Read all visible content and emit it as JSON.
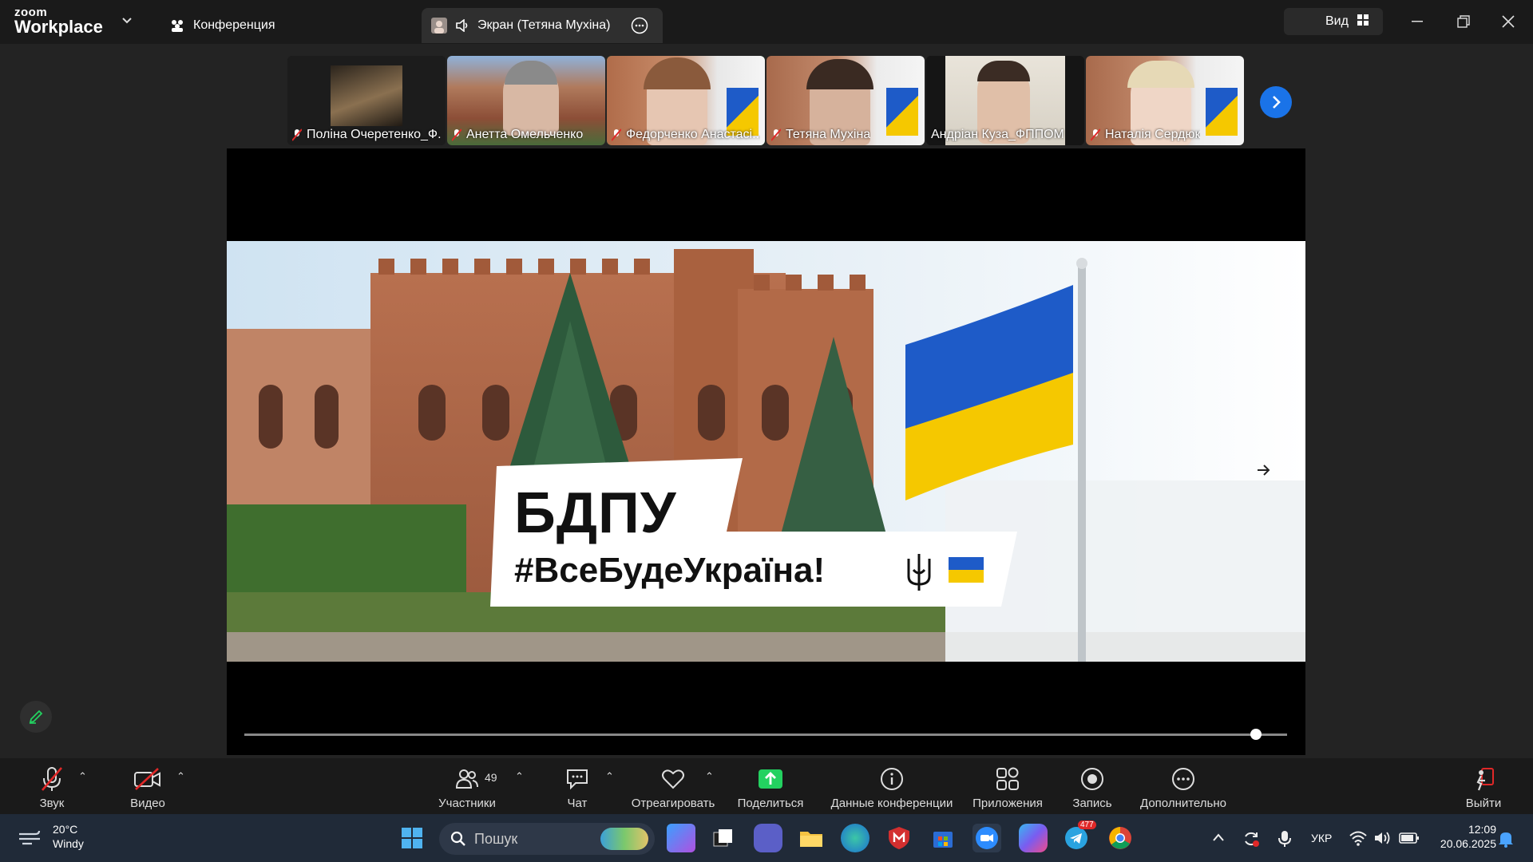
{
  "app": {
    "logo_top": "zoom",
    "logo_bottom": "Workplace"
  },
  "tabs": {
    "conference": "Конференция",
    "screen_share": "Экран (Тетяна Мухіна)"
  },
  "header": {
    "view_label": "Вид"
  },
  "participants": [
    {
      "name": "Поліна Очеретенко_Ф...",
      "muted": true
    },
    {
      "name": "Анетта Омельченко",
      "muted": true
    },
    {
      "name": "Федорченко Анастасі...",
      "muted": true,
      "active_speaker": true
    },
    {
      "name": "Тетяна Мухіна",
      "muted": true
    },
    {
      "name": "Андріан Куза_ФППОМ",
      "muted": false
    },
    {
      "name": "Наталія Сердюк",
      "muted": true
    }
  ],
  "slide": {
    "title": "БДПУ",
    "hashtag": "#ВсеБудеУкраїна!",
    "flag_colors": [
      "#1e5bc8",
      "#f5c800"
    ],
    "progress": 0.97
  },
  "toolbar": {
    "audio": "Звук",
    "video": "Видео",
    "participants": "Участники",
    "participants_count": "49",
    "chat": "Чат",
    "react": "Отреагировать",
    "share": "Поделиться",
    "info": "Данные конференции",
    "apps": "Приложения",
    "record": "Запись",
    "more": "Дополнительно",
    "leave": "Выйти"
  },
  "taskbar": {
    "weather_temp": "20°C",
    "weather_desc": "Windy",
    "search_placeholder": "Пошук",
    "telegram_badge": "477",
    "language": "УКР",
    "time": "12:09",
    "date": "20.06.2025"
  },
  "colors": {
    "accent_green": "#23d160",
    "zoom_blue": "#1a73e8",
    "share_green": "#23d160"
  }
}
